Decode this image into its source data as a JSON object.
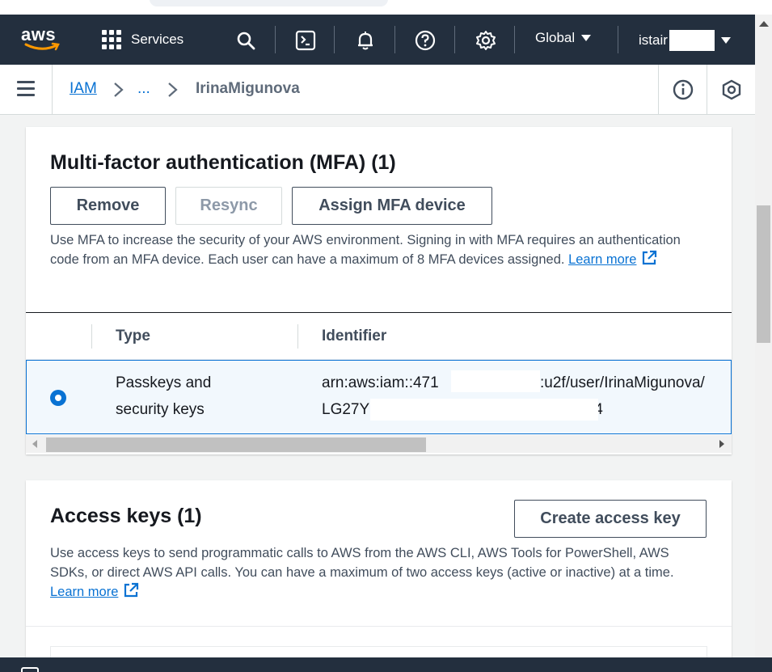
{
  "topnav": {
    "logo_text": "aws",
    "services_label": "Services",
    "region_label": "Global",
    "user_label": "istair",
    "icons": [
      "grid-icon",
      "search-icon",
      "cloudshell-icon",
      "bell-icon",
      "help-icon",
      "gear-icon"
    ]
  },
  "breadcrumb": {
    "root": "IAM",
    "ellipsis": "...",
    "current": "IrinaMigunova"
  },
  "mfa": {
    "title": "Multi-factor authentication (MFA) (1)",
    "buttons": {
      "remove": "Remove",
      "resync": "Resync",
      "assign": "Assign MFA device"
    },
    "description": "Use MFA to increase the security of your AWS environment. Signing in with MFA requires an authentication code from an MFA device. Each user can have a maximum of 8 MFA devices assigned.",
    "learn_more": "Learn more",
    "table": {
      "columns": [
        "Type",
        "Identifier"
      ],
      "rows": [
        {
          "type_line1": "Passkeys and",
          "type_line2": "security keys",
          "identifier_line1_start": "arn:aws:iam::471",
          "identifier_line1_end": ":u2f/user/IrinaMigunova/",
          "identifier_line2_start": "LG27Y",
          "identifier_line2_end": "'54"
        }
      ]
    }
  },
  "access_keys": {
    "title": "Access keys (1)",
    "create_button": "Create access key",
    "description": "Use access keys to send programmatic calls to AWS from the AWS CLI, AWS Tools for PowerShell, AWS SDKs, or direct AWS API calls. You can have a maximum of two access keys (active or inactive) at a time.",
    "learn_more": "Learn more"
  },
  "colors": {
    "nav_bg": "#232f3e",
    "link": "#0972d3",
    "aws_orange": "#ff9900"
  }
}
